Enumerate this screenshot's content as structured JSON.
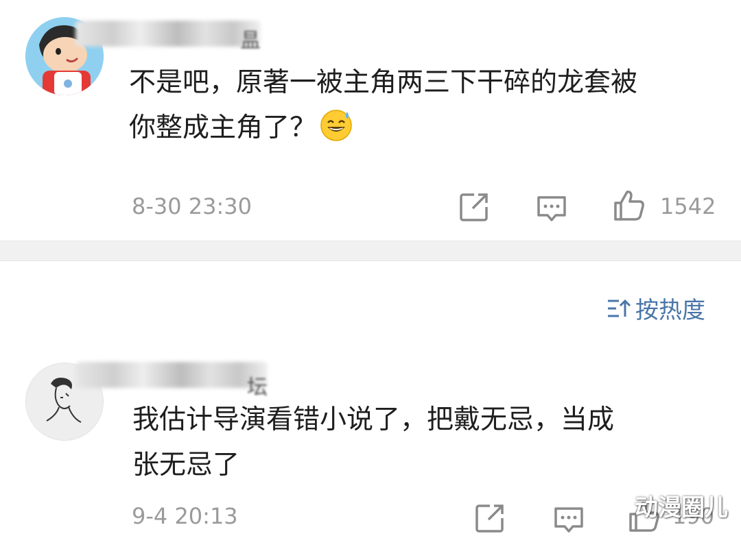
{
  "comments": [
    {
      "username_tail": "昷",
      "text_line1": "不是吧，原著一被主角两三下干碎的龙套被",
      "text_line2": "你整成主角了？",
      "emoji": "sweat-smile-emoji",
      "time": "8-30 23:30",
      "likes": "1542"
    },
    {
      "username_tail": "坛",
      "text_line1": "我估计导演看错小说了，把戴无忌，当成",
      "text_line2": "张无忌了",
      "time": "9-4 20:13",
      "likes": "190"
    }
  ],
  "sort": {
    "icon": "sort-icon",
    "label": "按热度"
  },
  "watermark": "动漫圈儿",
  "colors": {
    "link": "#4a76a8",
    "meta": "#9a9a9a",
    "band": "#f1f1f1"
  }
}
